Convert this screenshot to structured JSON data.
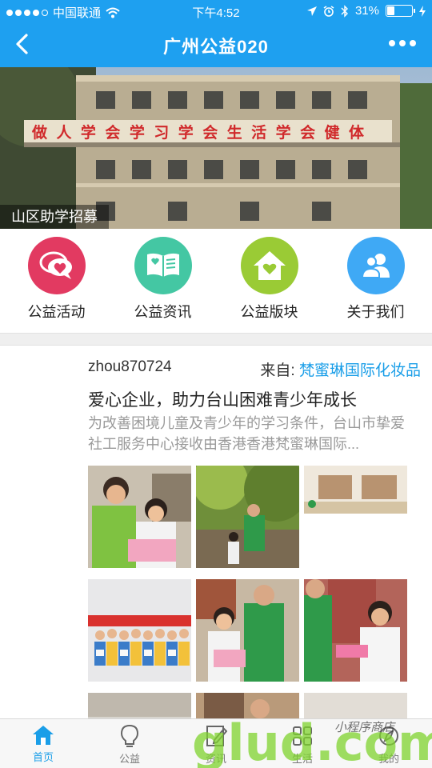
{
  "status_bar": {
    "carrier": "中国联通",
    "time": "下午4:52",
    "battery": "31%",
    "battery_level": 0.31
  },
  "nav": {
    "title": "广州公益020",
    "back_icon": "back-chevron-icon",
    "more_icon": "more-dots-icon"
  },
  "banner": {
    "caption": "山区助学招募",
    "sign_text": "做人学会学习学会生活学会健体"
  },
  "quick_menu": [
    {
      "label": "公益活动",
      "icon": "heart-chat-icon",
      "color": "#e23a61"
    },
    {
      "label": "公益资讯",
      "icon": "open-book-icon",
      "color": "#44c7a3"
    },
    {
      "label": "公益版块",
      "icon": "house-heart-icon",
      "color": "#9acb35"
    },
    {
      "label": "关于我们",
      "icon": "users-icon",
      "color": "#3fa9f5"
    }
  ],
  "post": {
    "username": "zhou870724",
    "from_prefix": "来自:",
    "source": "梵蜜琳国际化妆品",
    "title": "爱心企业，助力台山困难青少年成长",
    "description": "为改善困境儿童及青少年的学习条件，台山市挚爱社工服务中心接收由香港香港梵蜜琳国际..."
  },
  "tabbar": [
    {
      "label": "首页",
      "icon": "home-icon",
      "active": true
    },
    {
      "label": "公益",
      "icon": "lightbulb-icon",
      "active": false
    },
    {
      "label": "资讯",
      "icon": "edit-note-icon",
      "active": false
    },
    {
      "label": "生活",
      "icon": "grid-icon",
      "active": false
    },
    {
      "label": "我的",
      "icon": "compass-icon",
      "active": false
    }
  ],
  "watermark": {
    "text": "glud.com",
    "subtext": "小程序商店"
  },
  "colors": {
    "primary": "#1ea0f0",
    "link": "#1a9ee8"
  }
}
